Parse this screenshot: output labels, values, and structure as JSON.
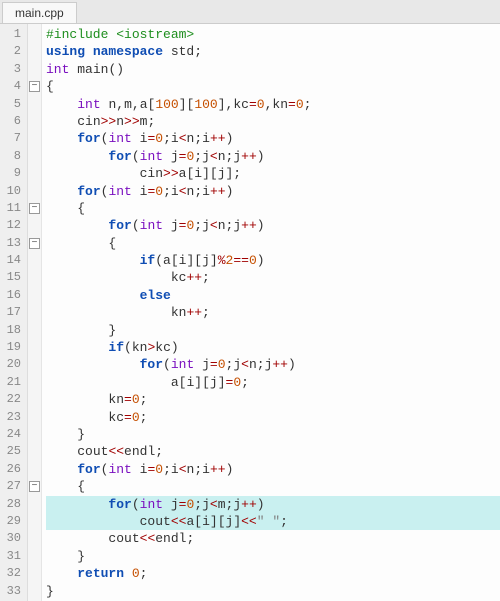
{
  "tab": {
    "filename": "main.cpp"
  },
  "editor": {
    "highlighted_lines": [
      28,
      29
    ],
    "fold_markers": [
      4,
      11,
      13,
      27
    ],
    "lines": [
      {
        "n": 1,
        "tokens": [
          [
            "pp",
            "#include "
          ],
          [
            "pp",
            "<iostream>"
          ]
        ]
      },
      {
        "n": 2,
        "tokens": [
          [
            "kw",
            "using "
          ],
          [
            "kw",
            "namespace "
          ],
          [
            "id",
            "std"
          ],
          [
            "punc",
            ";"
          ]
        ]
      },
      {
        "n": 3,
        "tokens": [
          [
            "type",
            "int "
          ],
          [
            "id",
            "main"
          ],
          [
            "punc",
            "()"
          ]
        ]
      },
      {
        "n": 4,
        "tokens": [
          [
            "punc",
            "{"
          ]
        ]
      },
      {
        "n": 5,
        "tokens": [
          [
            "sp",
            "    "
          ],
          [
            "type",
            "int "
          ],
          [
            "id",
            "n"
          ],
          [
            "punc",
            ","
          ],
          [
            "id",
            "m"
          ],
          [
            "punc",
            ","
          ],
          [
            "id",
            "a"
          ],
          [
            "punc",
            "["
          ],
          [
            "num",
            "100"
          ],
          [
            "punc",
            "]["
          ],
          [
            "num",
            "100"
          ],
          [
            "punc",
            "],"
          ],
          [
            "id",
            "kc"
          ],
          [
            "op",
            "="
          ],
          [
            "num",
            "0"
          ],
          [
            "punc",
            ","
          ],
          [
            "id",
            "kn"
          ],
          [
            "op",
            "="
          ],
          [
            "num",
            "0"
          ],
          [
            "punc",
            ";"
          ]
        ]
      },
      {
        "n": 6,
        "tokens": [
          [
            "sp",
            "    "
          ],
          [
            "id",
            "cin"
          ],
          [
            "op",
            ">>"
          ],
          [
            "id",
            "n"
          ],
          [
            "op",
            ">>"
          ],
          [
            "id",
            "m"
          ],
          [
            "punc",
            ";"
          ]
        ]
      },
      {
        "n": 7,
        "tokens": [
          [
            "sp",
            "    "
          ],
          [
            "kw",
            "for"
          ],
          [
            "punc",
            "("
          ],
          [
            "type",
            "int "
          ],
          [
            "id",
            "i"
          ],
          [
            "op",
            "="
          ],
          [
            "num",
            "0"
          ],
          [
            "punc",
            ";"
          ],
          [
            "id",
            "i"
          ],
          [
            "op",
            "<"
          ],
          [
            "id",
            "n"
          ],
          [
            "punc",
            ";"
          ],
          [
            "id",
            "i"
          ],
          [
            "op",
            "++"
          ],
          [
            "punc",
            ")"
          ]
        ]
      },
      {
        "n": 8,
        "tokens": [
          [
            "sp",
            "        "
          ],
          [
            "kw",
            "for"
          ],
          [
            "punc",
            "("
          ],
          [
            "type",
            "int "
          ],
          [
            "id",
            "j"
          ],
          [
            "op",
            "="
          ],
          [
            "num",
            "0"
          ],
          [
            "punc",
            ";"
          ],
          [
            "id",
            "j"
          ],
          [
            "op",
            "<"
          ],
          [
            "id",
            "n"
          ],
          [
            "punc",
            ";"
          ],
          [
            "id",
            "j"
          ],
          [
            "op",
            "++"
          ],
          [
            "punc",
            ")"
          ]
        ]
      },
      {
        "n": 9,
        "tokens": [
          [
            "sp",
            "            "
          ],
          [
            "id",
            "cin"
          ],
          [
            "op",
            ">>"
          ],
          [
            "id",
            "a"
          ],
          [
            "punc",
            "["
          ],
          [
            "id",
            "i"
          ],
          [
            "punc",
            "]["
          ],
          [
            "id",
            "j"
          ],
          [
            "punc",
            "];"
          ]
        ]
      },
      {
        "n": 10,
        "tokens": [
          [
            "sp",
            "    "
          ],
          [
            "kw",
            "for"
          ],
          [
            "punc",
            "("
          ],
          [
            "type",
            "int "
          ],
          [
            "id",
            "i"
          ],
          [
            "op",
            "="
          ],
          [
            "num",
            "0"
          ],
          [
            "punc",
            ";"
          ],
          [
            "id",
            "i"
          ],
          [
            "op",
            "<"
          ],
          [
            "id",
            "n"
          ],
          [
            "punc",
            ";"
          ],
          [
            "id",
            "i"
          ],
          [
            "op",
            "++"
          ],
          [
            "punc",
            ")"
          ]
        ]
      },
      {
        "n": 11,
        "tokens": [
          [
            "sp",
            "    "
          ],
          [
            "punc",
            "{"
          ]
        ]
      },
      {
        "n": 12,
        "tokens": [
          [
            "sp",
            "        "
          ],
          [
            "kw",
            "for"
          ],
          [
            "punc",
            "("
          ],
          [
            "type",
            "int "
          ],
          [
            "id",
            "j"
          ],
          [
            "op",
            "="
          ],
          [
            "num",
            "0"
          ],
          [
            "punc",
            ";"
          ],
          [
            "id",
            "j"
          ],
          [
            "op",
            "<"
          ],
          [
            "id",
            "n"
          ],
          [
            "punc",
            ";"
          ],
          [
            "id",
            "j"
          ],
          [
            "op",
            "++"
          ],
          [
            "punc",
            ")"
          ]
        ]
      },
      {
        "n": 13,
        "tokens": [
          [
            "sp",
            "        "
          ],
          [
            "punc",
            "{"
          ]
        ]
      },
      {
        "n": 14,
        "tokens": [
          [
            "sp",
            "            "
          ],
          [
            "kw",
            "if"
          ],
          [
            "punc",
            "("
          ],
          [
            "id",
            "a"
          ],
          [
            "punc",
            "["
          ],
          [
            "id",
            "i"
          ],
          [
            "punc",
            "]["
          ],
          [
            "id",
            "j"
          ],
          [
            "punc",
            "]"
          ],
          [
            "op",
            "%"
          ],
          [
            "num",
            "2"
          ],
          [
            "op",
            "=="
          ],
          [
            "num",
            "0"
          ],
          [
            "punc",
            ")"
          ]
        ]
      },
      {
        "n": 15,
        "tokens": [
          [
            "sp",
            "                "
          ],
          [
            "id",
            "kc"
          ],
          [
            "op",
            "++"
          ],
          [
            "punc",
            ";"
          ]
        ]
      },
      {
        "n": 16,
        "tokens": [
          [
            "sp",
            "            "
          ],
          [
            "kw",
            "else"
          ]
        ]
      },
      {
        "n": 17,
        "tokens": [
          [
            "sp",
            "                "
          ],
          [
            "id",
            "kn"
          ],
          [
            "op",
            "++"
          ],
          [
            "punc",
            ";"
          ]
        ]
      },
      {
        "n": 18,
        "tokens": [
          [
            "sp",
            "        "
          ],
          [
            "punc",
            "}"
          ]
        ]
      },
      {
        "n": 19,
        "tokens": [
          [
            "sp",
            "        "
          ],
          [
            "kw",
            "if"
          ],
          [
            "punc",
            "("
          ],
          [
            "id",
            "kn"
          ],
          [
            "op",
            ">"
          ],
          [
            "id",
            "kc"
          ],
          [
            "punc",
            ")"
          ]
        ]
      },
      {
        "n": 20,
        "tokens": [
          [
            "sp",
            "            "
          ],
          [
            "kw",
            "for"
          ],
          [
            "punc",
            "("
          ],
          [
            "type",
            "int "
          ],
          [
            "id",
            "j"
          ],
          [
            "op",
            "="
          ],
          [
            "num",
            "0"
          ],
          [
            "punc",
            ";"
          ],
          [
            "id",
            "j"
          ],
          [
            "op",
            "<"
          ],
          [
            "id",
            "n"
          ],
          [
            "punc",
            ";"
          ],
          [
            "id",
            "j"
          ],
          [
            "op",
            "++"
          ],
          [
            "punc",
            ")"
          ]
        ]
      },
      {
        "n": 21,
        "tokens": [
          [
            "sp",
            "                "
          ],
          [
            "id",
            "a"
          ],
          [
            "punc",
            "["
          ],
          [
            "id",
            "i"
          ],
          [
            "punc",
            "]["
          ],
          [
            "id",
            "j"
          ],
          [
            "punc",
            "]"
          ],
          [
            "op",
            "="
          ],
          [
            "num",
            "0"
          ],
          [
            "punc",
            ";"
          ]
        ]
      },
      {
        "n": 22,
        "tokens": [
          [
            "sp",
            "        "
          ],
          [
            "id",
            "kn"
          ],
          [
            "op",
            "="
          ],
          [
            "num",
            "0"
          ],
          [
            "punc",
            ";"
          ]
        ]
      },
      {
        "n": 23,
        "tokens": [
          [
            "sp",
            "        "
          ],
          [
            "id",
            "kc"
          ],
          [
            "op",
            "="
          ],
          [
            "num",
            "0"
          ],
          [
            "punc",
            ";"
          ]
        ]
      },
      {
        "n": 24,
        "tokens": [
          [
            "sp",
            "    "
          ],
          [
            "punc",
            "}"
          ]
        ]
      },
      {
        "n": 25,
        "tokens": [
          [
            "sp",
            "    "
          ],
          [
            "id",
            "cout"
          ],
          [
            "op",
            "<<"
          ],
          [
            "id",
            "endl"
          ],
          [
            "punc",
            ";"
          ]
        ]
      },
      {
        "n": 26,
        "tokens": [
          [
            "sp",
            "    "
          ],
          [
            "kw",
            "for"
          ],
          [
            "punc",
            "("
          ],
          [
            "type",
            "int "
          ],
          [
            "id",
            "i"
          ],
          [
            "op",
            "="
          ],
          [
            "num",
            "0"
          ],
          [
            "punc",
            ";"
          ],
          [
            "id",
            "i"
          ],
          [
            "op",
            "<"
          ],
          [
            "id",
            "n"
          ],
          [
            "punc",
            ";"
          ],
          [
            "id",
            "i"
          ],
          [
            "op",
            "++"
          ],
          [
            "punc",
            ")"
          ]
        ]
      },
      {
        "n": 27,
        "tokens": [
          [
            "sp",
            "    "
          ],
          [
            "punc",
            "{"
          ]
        ]
      },
      {
        "n": 28,
        "tokens": [
          [
            "sp",
            "        "
          ],
          [
            "kw",
            "for"
          ],
          [
            "punc",
            "("
          ],
          [
            "type",
            "int "
          ],
          [
            "id",
            "j"
          ],
          [
            "op",
            "="
          ],
          [
            "num",
            "0"
          ],
          [
            "punc",
            ";"
          ],
          [
            "id",
            "j"
          ],
          [
            "op",
            "<"
          ],
          [
            "id",
            "m"
          ],
          [
            "punc",
            ";"
          ],
          [
            "id",
            "j"
          ],
          [
            "op",
            "++"
          ],
          [
            "punc",
            ")"
          ]
        ]
      },
      {
        "n": 29,
        "tokens": [
          [
            "sp",
            "            "
          ],
          [
            "id",
            "cout"
          ],
          [
            "op",
            "<<"
          ],
          [
            "id",
            "a"
          ],
          [
            "punc",
            "["
          ],
          [
            "id",
            "i"
          ],
          [
            "punc",
            "]["
          ],
          [
            "id",
            "j"
          ],
          [
            "punc",
            "]"
          ],
          [
            "op",
            "<<"
          ],
          [
            "str",
            "\" \""
          ],
          [
            "punc",
            ";"
          ]
        ]
      },
      {
        "n": 30,
        "tokens": [
          [
            "sp",
            "        "
          ],
          [
            "id",
            "cout"
          ],
          [
            "op",
            "<<"
          ],
          [
            "id",
            "endl"
          ],
          [
            "punc",
            ";"
          ]
        ]
      },
      {
        "n": 31,
        "tokens": [
          [
            "sp",
            "    "
          ],
          [
            "punc",
            "}"
          ]
        ]
      },
      {
        "n": 32,
        "tokens": [
          [
            "sp",
            "    "
          ],
          [
            "kw",
            "return "
          ],
          [
            "num",
            "0"
          ],
          [
            "punc",
            ";"
          ]
        ]
      },
      {
        "n": 33,
        "tokens": [
          [
            "punc",
            "}"
          ]
        ]
      }
    ]
  }
}
